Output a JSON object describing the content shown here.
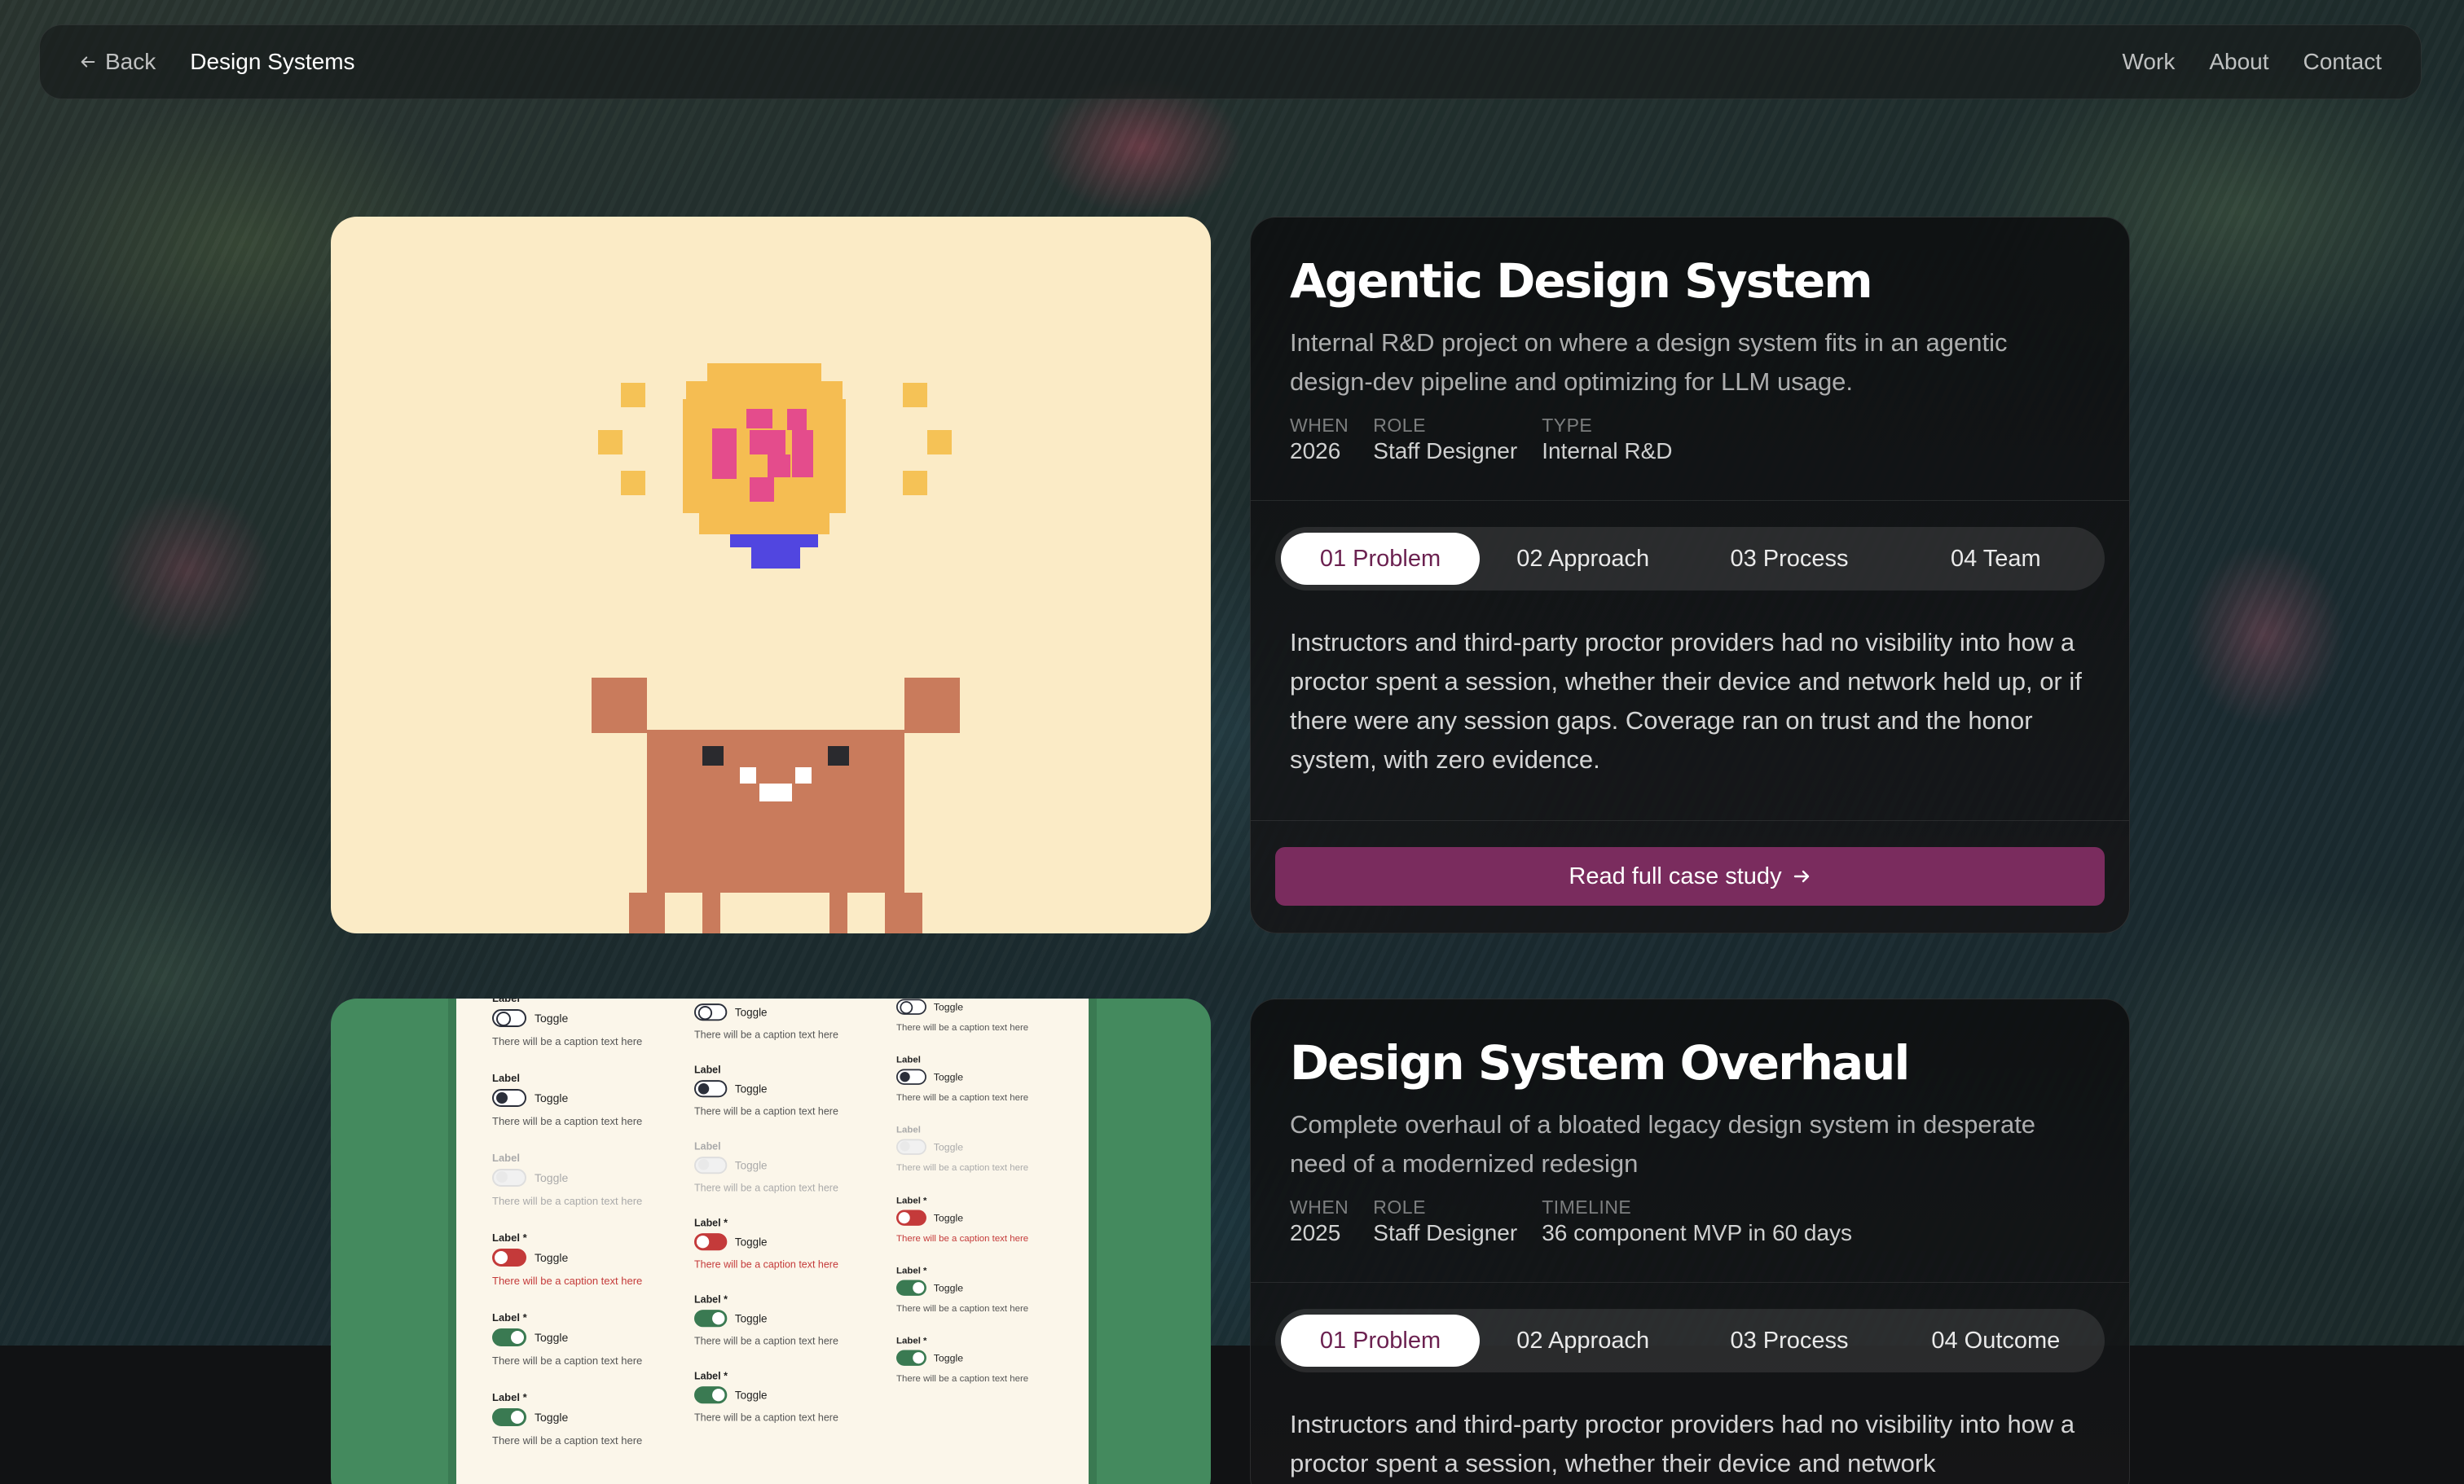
{
  "nav": {
    "back_label": "Back",
    "title": "Design Systems",
    "links": [
      "Work",
      "About",
      "Contact"
    ]
  },
  "projects": [
    {
      "title": "Agentic Design System",
      "description": "Internal R&D project on where a design system fits in an agentic design-dev pipeline and optimizing for LLM usage.",
      "meta": [
        {
          "key": "WHEN",
          "value": "2026"
        },
        {
          "key": "ROLE",
          "value": "Staff Designer"
        },
        {
          "key": "TYPE",
          "value": "Internal R&D"
        }
      ],
      "tabs": [
        "01 Problem",
        "02 Approach",
        "03 Process",
        "04 Team"
      ],
      "active_tab": "01 Problem",
      "body": "Instructors and third-party proctor providers had no visibility into how a proctor spent a session, whether their device and network held up, or if there were any session gaps. Coverage ran on trust and the honor system, with zero evidence.",
      "cta": "Read full case study"
    },
    {
      "title": "Design System Overhaul",
      "description": "Complete overhaul of a bloated legacy design system in desperate need of a modernized redesign",
      "meta": [
        {
          "key": "WHEN",
          "value": "2025"
        },
        {
          "key": "ROLE",
          "value": "Staff Designer"
        },
        {
          "key": "TIMELINE",
          "value": "36 component MVP in 60 days"
        }
      ],
      "tabs": [
        "01 Problem",
        "02 Approach",
        "03 Process",
        "04 Outcome"
      ],
      "active_tab": "01 Problem",
      "body": "Instructors and third-party proctor providers had no visibility into how a proctor spent a session, whether their device and network"
    }
  ],
  "toggle_doc": {
    "label": "Label",
    "required_label": "Label *",
    "toggle_text": "Toggle",
    "caption": "There will be a caption text here",
    "states": [
      "off",
      "half",
      "disabled",
      "error",
      "on",
      "on"
    ]
  },
  "colors": {
    "accent": "#7a2c5e",
    "active_tab_text": "#6b2150",
    "hero1_bg": "#fbebc6",
    "hero2_bg": "#448a5e"
  },
  "icons": {
    "back": "arrow-left-icon",
    "cta": "arrow-right-icon"
  }
}
